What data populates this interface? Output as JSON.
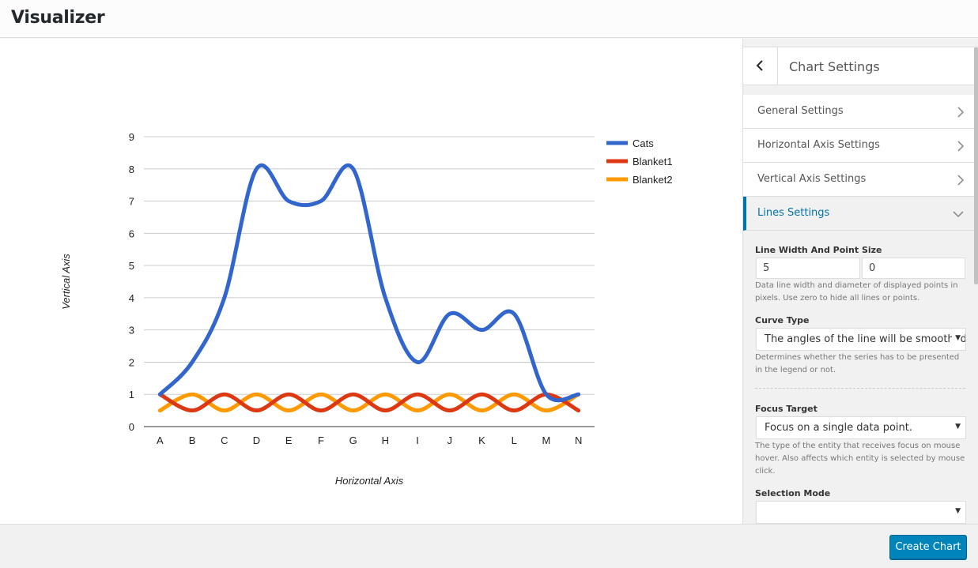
{
  "app": {
    "title": "Visualizer"
  },
  "sidebar": {
    "title": "Chart Settings",
    "sections": [
      {
        "label": "General Settings"
      },
      {
        "label": "Horizontal Axis Settings"
      },
      {
        "label": "Vertical Axis Settings"
      },
      {
        "label": "Lines Settings"
      }
    ],
    "lines": {
      "line_width_title": "Line Width And Point Size",
      "line_width_value": "5",
      "point_size_value": "0",
      "line_width_desc": "Data line width and diameter of displayed points in pixels. Use zero to hide all lines or points.",
      "curve_type_title": "Curve Type",
      "curve_type_value": "The angles of the line will be smoothed.",
      "curve_type_desc": "Determines whether the series has to be presented in the legend or not.",
      "focus_target_title": "Focus Target",
      "focus_target_value": "Focus on a single data point.",
      "focus_target_desc": "The type of the entity that receives focus on mouse hover. Also affects which entity is selected by mouse click.",
      "selection_mode_title": "Selection Mode",
      "selection_mode_value": ""
    }
  },
  "footer": {
    "create_label": "Create Chart"
  },
  "colors": {
    "accent": "#0073aa",
    "button": "#0085ba"
  },
  "chart_data": {
    "type": "line",
    "categories": [
      "A",
      "B",
      "C",
      "D",
      "E",
      "F",
      "G",
      "H",
      "I",
      "J",
      "K",
      "L",
      "M",
      "N"
    ],
    "series": [
      {
        "name": "Cats",
        "color": "#3366cc",
        "values": [
          1,
          2,
          4,
          8,
          7,
          7,
          8,
          4,
          2,
          3.5,
          3,
          3.5,
          1,
          1
        ]
      },
      {
        "name": "Blanket1",
        "color": "#dc3912",
        "values": [
          1,
          0.5,
          1,
          0.5,
          1,
          0.5,
          1,
          0.5,
          1,
          0.5,
          1,
          0.5,
          1,
          0.5
        ]
      },
      {
        "name": "Blanket2",
        "color": "#ff9900",
        "values": [
          0.5,
          1,
          0.5,
          1,
          0.5,
          1,
          0.5,
          1,
          0.5,
          1,
          0.5,
          1,
          0.5,
          1
        ]
      }
    ],
    "xlabel": "Horizontal Axis",
    "ylabel": "Vertical Axis",
    "ylim": [
      0,
      9
    ],
    "yticks": [
      0,
      1,
      2,
      3,
      4,
      5,
      6,
      7,
      8,
      9
    ],
    "grid": true,
    "legend": "right",
    "curve": "smooth"
  }
}
